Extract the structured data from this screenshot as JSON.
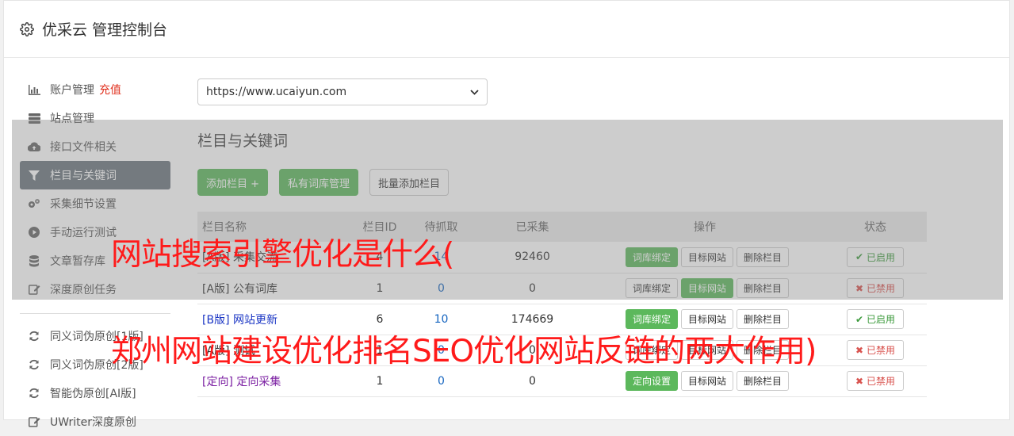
{
  "header": {
    "title": "优采云 管理控制台",
    "icon": "gear-icon"
  },
  "sidebar": {
    "items": [
      {
        "label": "账户管理",
        "icon": "bar-chart-icon",
        "extra": "充值"
      },
      {
        "label": "站点管理",
        "icon": "server-icon"
      },
      {
        "label": "接口文件相关",
        "icon": "cloud-upload-icon"
      },
      {
        "label": "栏目与关键词",
        "icon": "filter-icon"
      },
      {
        "label": "采集细节设置",
        "icon": "gears-icon"
      },
      {
        "label": "手动运行测试",
        "icon": "play-circle-icon"
      },
      {
        "label": "文章暂存库",
        "icon": "database-icon"
      },
      {
        "label": "深度原创任务",
        "icon": "edit-icon"
      },
      {
        "label": "同义词伪原创[1版]",
        "icon": "refresh-icon"
      },
      {
        "label": "同义词伪原创[2版]",
        "icon": "refresh-icon"
      },
      {
        "label": "智能伪原创[AI版]",
        "icon": "refresh-icon"
      },
      {
        "label": "UWriter深度原创",
        "icon": "edit-icon"
      }
    ]
  },
  "site_select": {
    "value": "https://www.ucaiyun.com"
  },
  "section": {
    "title": "栏目与关键词",
    "add_button": "添加栏目 +",
    "private_button": "私有词库管理",
    "batch_button": "批量添加栏目"
  },
  "table": {
    "headers": [
      "栏目名称",
      "栏目ID",
      "待抓取",
      "已采集",
      "操作",
      "状态"
    ],
    "rows": [
      {
        "prefix": "[A版]",
        "name": "采集交流",
        "id": "4",
        "pending": "14",
        "collected": "92460",
        "op1": "词库绑定",
        "op2": "目标网站",
        "op3": "删除栏目",
        "status": "已启用"
      },
      {
        "prefix": "[A版]",
        "name": "公有词库",
        "id": "1",
        "pending": "0",
        "collected": "0",
        "op1": "词库绑定",
        "op2": "目标网站",
        "op3": "删除栏目",
        "status": "已禁用"
      },
      {
        "prefix": "[B版]",
        "name": "网站更新",
        "id": "6",
        "pending": "10",
        "collected": "174669",
        "op1": "词库绑定",
        "op2": "目标网站",
        "op3": "删除栏目",
        "status": "已启用"
      },
      {
        "prefix": "[A版]",
        "name": "测试",
        "id": "1",
        "pending": "0",
        "collected": "0",
        "op1": "词库绑定",
        "op2": "目标网站",
        "op3": "删除栏目",
        "status": "已禁用"
      },
      {
        "prefix": "[定向]",
        "name": "定向采集",
        "id": "1",
        "pending": "0",
        "collected": "0",
        "op1": "定向设置",
        "op2": "目标网站",
        "op3": "删除栏目",
        "status": "已禁用"
      }
    ]
  },
  "overlay_text": {
    "line1": "网站搜索引擎优化是什么(",
    "line2": "郑州网站建设优化排名SEO优化网站反链的两大作用)"
  },
  "colors": {
    "green": "#5cb85c",
    "red_overlay": "#ff1a1a",
    "active_nav": "#6c757d"
  }
}
